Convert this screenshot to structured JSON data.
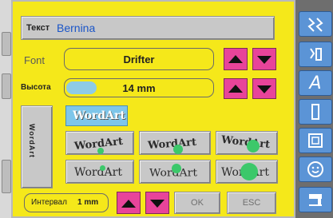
{
  "header": {
    "label": "Текст",
    "value": "Bernina"
  },
  "font_row": {
    "label": "Font",
    "value": "Drifter"
  },
  "height_row": {
    "label": "Высота",
    "value": "14 mm"
  },
  "vertical_button": {
    "label": "WordArt"
  },
  "wordart_styles": {
    "selected_label": "WordArt",
    "tiles": [
      "WordArt",
      "WordArt",
      "WordArt",
      "WordArt",
      "WordArt",
      "WordArt"
    ]
  },
  "bottom": {
    "spacing_label": "Интервал",
    "spacing_value": "1 mm",
    "ok_label": "OK",
    "esc_label": "ESC"
  },
  "colors": {
    "panel": "#f5e81a",
    "arrow_button": "#e8449a",
    "toolbar_button": "#5b94d6"
  }
}
